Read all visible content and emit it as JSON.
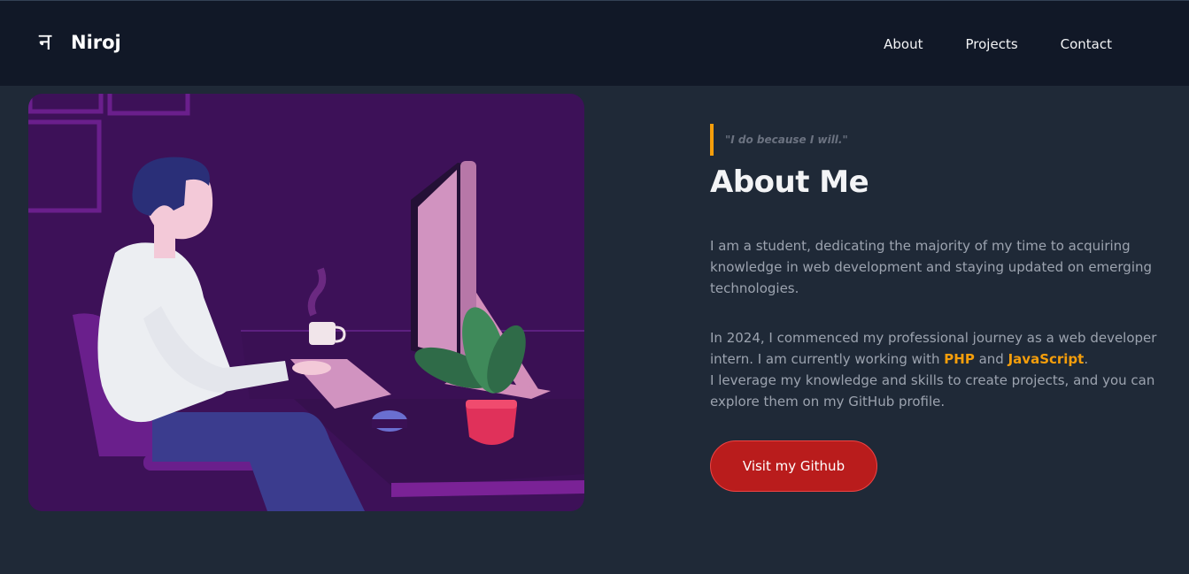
{
  "brand": {
    "logo_glyph": "न",
    "name": "Niroj"
  },
  "nav": {
    "items": [
      {
        "label": "About"
      },
      {
        "label": "Projects"
      },
      {
        "label": "Contact"
      }
    ]
  },
  "hero": {
    "image_icon": "developer-at-desk-illustration"
  },
  "about": {
    "quote": "\"I do because I will.\"",
    "title": "About Me",
    "paragraph1": "I am a student, dedicating the majority of my time to acquiring knowledge in web development and staying updated on emerging technologies.",
    "paragraph2_part1": "In 2024, I commenced my professional journey as a web developer intern. I am currently working with ",
    "highlight1": "PHP",
    "paragraph2_and": " and ",
    "highlight2": "JavaScript",
    "paragraph2_end": ".",
    "paragraph2_part2": "I leverage my knowledge and skills to create projects, and you can explore them on my GitHub profile.",
    "button_label": "Visit my Github"
  },
  "colors": {
    "background": "#1f2937",
    "navbar": "#111827",
    "accent": "#f59e0b",
    "button": "#b91c1c"
  }
}
